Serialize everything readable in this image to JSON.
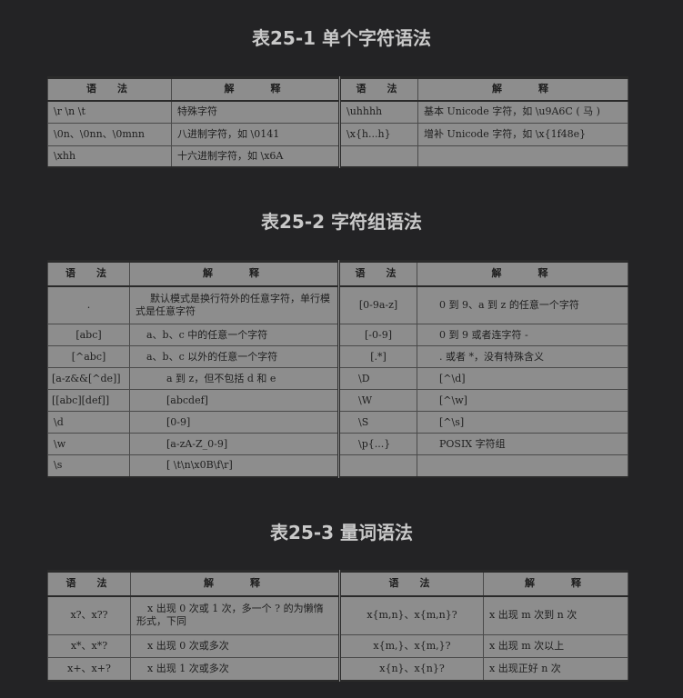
{
  "t1": {
    "title": "表25-1 单个字符语法",
    "h": [
      "语　法",
      "解　　释",
      "语　法",
      "解　　释"
    ],
    "rows": [
      [
        "\\r \\n \\t",
        "特殊字符",
        "\\uhhhh",
        "基本 Unicode 字符，如 \\u9A6C ( 马 )"
      ],
      [
        "\\0n、\\0nn、\\0mnn",
        "八进制字符，如 \\0141",
        "\\x{h...h}",
        "增补 Unicode 字符，如 \\x{1f48e}"
      ],
      [
        "\\xhh",
        "十六进制字符，如 \\x6A",
        "",
        ""
      ]
    ]
  },
  "t2": {
    "title": "表25-2 字符组语法",
    "h": [
      "语　法",
      "解　　释",
      "语　法",
      "解　　释"
    ],
    "rows": [
      [
        ".",
        "默认模式是换行符外的任意字符，单行模式是任意字符",
        "[0-9a-z]",
        "0 到 9、a 到 z 的任意一个字符"
      ],
      [
        "[abc]",
        "a、b、c 中的任意一个字符",
        "[-0-9]",
        "0 到 9 或者连字符 -"
      ],
      [
        "[^abc]",
        "a、b、c 以外的任意一个字符",
        "[.*]",
        ". 或者 *，没有特殊含义"
      ],
      [
        "[a-z&&[^de]]",
        "a 到 z，但不包括 d 和 e",
        "\\D",
        "[^\\d]"
      ],
      [
        "[[abc][def]]",
        "[abcdef]",
        "\\W",
        "[^\\w]"
      ],
      [
        "\\d",
        "[0-9]",
        "\\S",
        "[^\\s]"
      ],
      [
        "\\w",
        "[a-zA-Z_0-9]",
        "\\p{...}",
        "POSIX 字符组"
      ],
      [
        "\\s",
        "[ \\t\\n\\x0B\\f\\r]",
        "",
        ""
      ]
    ]
  },
  "t3": {
    "title": "表25-3 量词语法",
    "h": [
      "语　法",
      "解　　释",
      "语　法",
      "解　　释"
    ],
    "rows": [
      [
        "x?、x??",
        "x 出现 0 次或 1 次，多一个 ? 的为懒惰形式，下同",
        "x{m,n}、x{m,n}?",
        "x 出现 m 次到 n 次"
      ],
      [
        "x*、x*?",
        "x 出现 0 次或多次",
        "x{m,}、x{m,}?",
        "x 出现 m 次以上"
      ],
      [
        "x+、x+?",
        "x 出现 1 次或多次",
        "x{n}、x{n}?",
        "x 出现正好 n 次"
      ]
    ]
  }
}
